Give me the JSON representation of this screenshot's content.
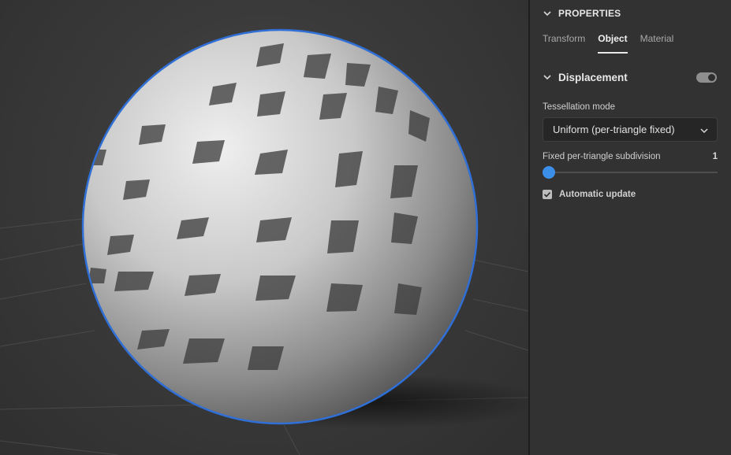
{
  "panel": {
    "title": "PROPERTIES",
    "tabs": [
      {
        "label": "Transform",
        "active": false
      },
      {
        "label": "Object",
        "active": true
      },
      {
        "label": "Material",
        "active": false
      }
    ],
    "section": {
      "title": "Displacement",
      "toggle_on": true
    },
    "tessellation": {
      "label": "Tessellation mode",
      "value": "Uniform (per-triangle fixed)"
    },
    "subdivision": {
      "label": "Fixed per-triangle subdivision",
      "value": "1",
      "fill_fraction": 0.0
    },
    "auto_update": {
      "label": "Automatic update",
      "checked": true
    }
  },
  "colors": {
    "accent": "#3c8fe8",
    "selection_outline": "#2f6fd6",
    "panel_bg": "#323232",
    "viewport_bg": "#3a3a3a"
  },
  "icons": {
    "section_chevron": "chevron-down-icon",
    "dropdown_caret": "chevron-down-icon",
    "checkbox_mark": "checkmark-icon"
  }
}
